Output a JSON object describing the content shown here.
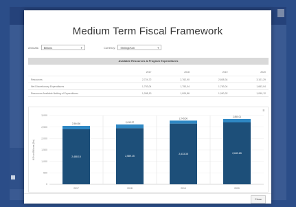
{
  "modal": {
    "title": "Medium Term Fiscal Framework",
    "close_label": "Close"
  },
  "filters": {
    "annuals": {
      "label": "Annuals:",
      "value": "Billions"
    },
    "category": {
      "label": "Currency:",
      "value": "Shilingi/Ksh"
    }
  },
  "table": {
    "title": "Available Resources & Program Expenditures",
    "columns": [
      "",
      "2017",
      "2018",
      "2019",
      "2020"
    ],
    "rows": [
      {
        "label": "Resources",
        "values": [
          "2,724,72",
          "2,762,90",
          "2,808,34",
          "3,101,29"
        ]
      },
      {
        "label": "Net Discretionary Expenditures",
        "values": [
          "1,753,04",
          "1,753,04",
          "1,763,04",
          "1,663,04"
        ]
      },
      {
        "label": "Resources Available Netting of Expenditures",
        "values": [
          "1,008,13",
          "1,009,86",
          "1,090,32",
          "1,099,12"
        ]
      }
    ]
  },
  "chart_data": {
    "type": "bar",
    "categories": [
      "2017",
      "2018",
      "2019",
      "2020"
    ],
    "series": [
      {
        "values": [
          2400,
          2450,
          2650,
          2700
        ]
      },
      {
        "values": [
          150,
          160,
          130,
          150
        ]
      }
    ],
    "data_labels": [
      "2,488.15",
      "2,589.15",
      "2,613.35",
      "2,649.65"
    ],
    "top_labels": [
      "2,564.66",
      "2,613.97",
      "2,745.50",
      "2,850.01"
    ],
    "ylabel": "KSh in Billions (Bn)",
    "ylim": [
      0,
      3000
    ],
    "yticks": [
      0,
      500,
      1000,
      1500,
      2000,
      2500,
      3000
    ],
    "colors": {
      "base": "#1d4f79",
      "top": "#2f88c4"
    },
    "grid": true
  }
}
